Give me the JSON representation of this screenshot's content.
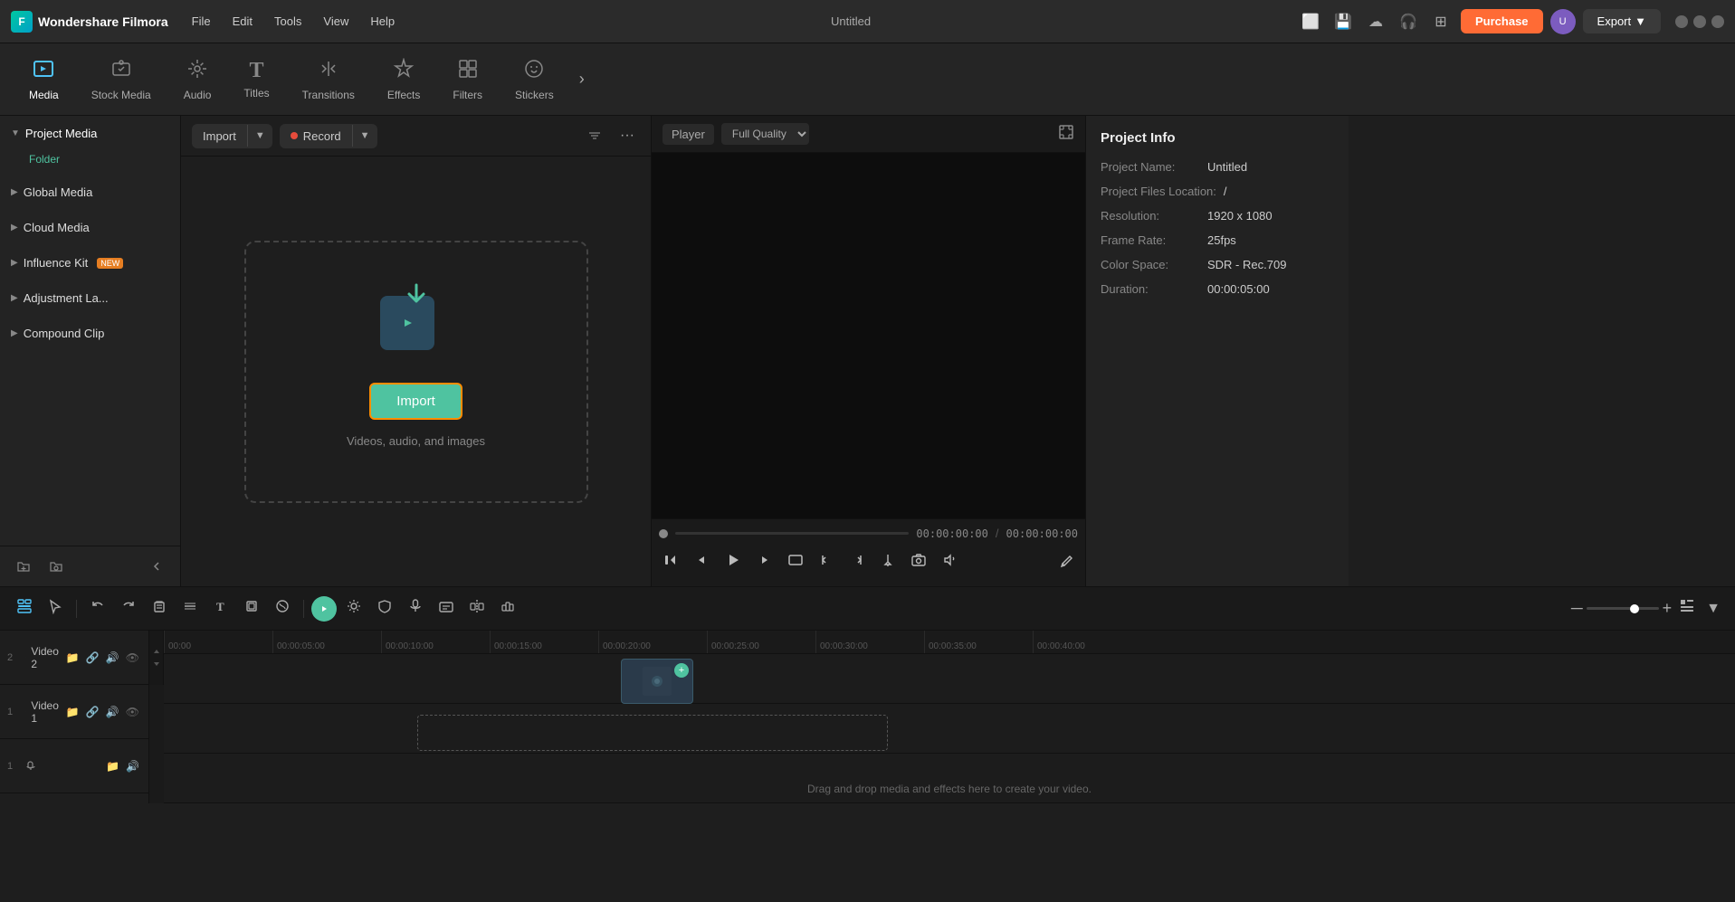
{
  "app": {
    "name": "Wondershare Filmora",
    "title": "Untitled"
  },
  "titlebar": {
    "menu": [
      "File",
      "Edit",
      "Tools",
      "View",
      "Help"
    ],
    "purchase_label": "Purchase",
    "export_label": "Export",
    "minimize": "─",
    "maximize": "□",
    "close": "✕"
  },
  "toolbar": {
    "tabs": [
      {
        "id": "media",
        "label": "Media",
        "icon": "⬛",
        "active": true
      },
      {
        "id": "stock",
        "label": "Stock Media",
        "icon": "🎬"
      },
      {
        "id": "audio",
        "label": "Audio",
        "icon": "🎵"
      },
      {
        "id": "titles",
        "label": "Titles",
        "icon": "T"
      },
      {
        "id": "transitions",
        "label": "Transitions",
        "icon": "↔"
      },
      {
        "id": "effects",
        "label": "Effects",
        "icon": "✨"
      },
      {
        "id": "filters",
        "label": "Filters",
        "icon": "🔳"
      },
      {
        "id": "stickers",
        "label": "Stickers",
        "icon": "😊"
      }
    ],
    "more": "›"
  },
  "left_panel": {
    "sections": [
      {
        "id": "project-media",
        "label": "Project Media",
        "expanded": true,
        "folder": "Folder"
      },
      {
        "id": "global-media",
        "label": "Global Media",
        "expanded": false
      },
      {
        "id": "cloud-media",
        "label": "Cloud Media",
        "expanded": false
      },
      {
        "id": "influence-kit",
        "label": "Influence Kit",
        "expanded": false,
        "badge": "NEW"
      },
      {
        "id": "adjustment-layer",
        "label": "Adjustment La...",
        "expanded": false
      },
      {
        "id": "compound-clip",
        "label": "Compound Clip",
        "expanded": false
      }
    ]
  },
  "content": {
    "import_label": "Import",
    "record_label": "Record",
    "import_drop": {
      "btn_label": "Import",
      "subtitle": "Videos, audio, and images"
    }
  },
  "preview": {
    "player_label": "Player",
    "quality_label": "Full Quality",
    "time_current": "00:00:00:00",
    "time_total": "00:00:00:00"
  },
  "project_info": {
    "title": "Project Info",
    "fields": [
      {
        "label": "Project Name:",
        "value": "Untitled"
      },
      {
        "label": "Project Files Location:",
        "value": "/"
      },
      {
        "label": "Resolution:",
        "value": "1920 x 1080"
      },
      {
        "label": "Frame Rate:",
        "value": "25fps"
      },
      {
        "label": "Color Space:",
        "value": "SDR - Rec.709"
      },
      {
        "label": "Duration:",
        "value": "00:00:05:00"
      }
    ]
  },
  "timeline": {
    "ruler_marks": [
      "00:00",
      "00:00:05:00",
      "00:00:10:00",
      "00:00:15:00",
      "00:00:20:00",
      "00:00:25:00",
      "00:00:30:00",
      "00:00:35:00",
      "00:00:40:00"
    ],
    "tracks": [
      {
        "id": "video2",
        "num": "2",
        "icon": "🎬",
        "name": "Video 2"
      },
      {
        "id": "video1",
        "num": "1",
        "icon": "🎬",
        "name": "Video 1"
      },
      {
        "id": "audio1",
        "num": "1",
        "icon": "🎵",
        "name": ""
      }
    ],
    "drag_drop_text": "Drag and drop media and effects here to create your video."
  }
}
